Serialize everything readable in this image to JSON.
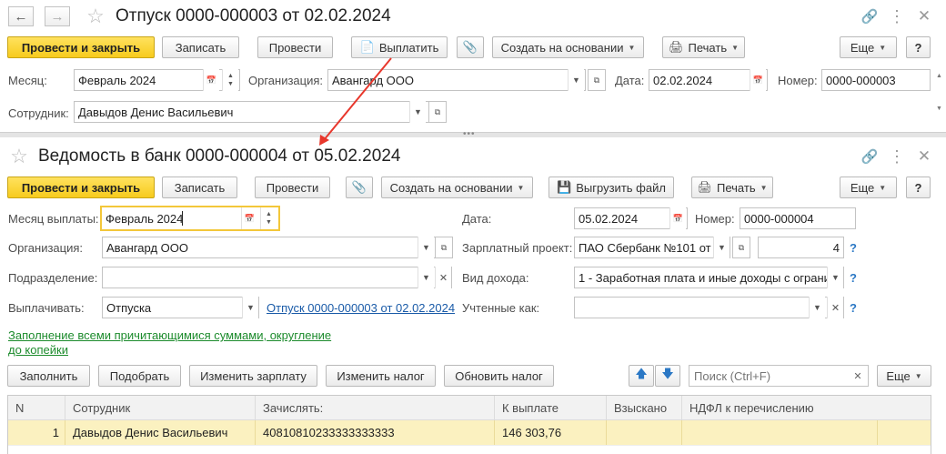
{
  "doc1": {
    "title": "Отпуск 0000-000003 от 02.02.2024",
    "toolbar": {
      "post_close": "Провести и закрыть",
      "save": "Записать",
      "post": "Провести",
      "pay": "Выплатить",
      "create_based": "Создать на основании",
      "print": "Печать",
      "more": "Еще",
      "help": "?"
    },
    "fields": {
      "month_label": "Месяц:",
      "month_value": "Февраль 2024",
      "org_label": "Организация:",
      "org_value": "Авангард ООО",
      "date_label": "Дата:",
      "date_value": "02.02.2024",
      "number_label": "Номер:",
      "number_value": "0000-000003",
      "employee_label": "Сотрудник:",
      "employee_value": "Давыдов Денис Васильевич"
    }
  },
  "doc2": {
    "title": "Ведомость в банк 0000-000004 от 05.02.2024",
    "toolbar": {
      "post_close": "Провести и закрыть",
      "save": "Записать",
      "post": "Провести",
      "create_based": "Создать на основании",
      "export": "Выгрузить файл",
      "print": "Печать",
      "more": "Еще",
      "help": "?"
    },
    "fields": {
      "pay_month_label": "Месяц выплаты:",
      "pay_month_value": "Февраль 2024",
      "date_label": "Дата:",
      "date_value": "05.02.2024",
      "number_label": "Номер:",
      "number_value": "0000-000004",
      "org_label": "Организация:",
      "org_value": "Авангард ООО",
      "salary_project_label": "Зарплатный проект:",
      "salary_project_value": "ПАО Сбербанк №101 от",
      "salary_project_num": "4",
      "division_label": "Подразделение:",
      "division_value": "",
      "income_type_label": "Вид дохода:",
      "income_type_value": "1 - Заработная плата и иные доходы с ограни",
      "pay_label": "Выплачивать:",
      "pay_value": "Отпуска",
      "pay_link": "Отпуск 0000-000003 от 02.02.2024",
      "accounted_label": "Учтенные как:",
      "accounted_value": ""
    },
    "fill_link": "Заполнение всеми причитающимися суммами, округление до копейки",
    "table_toolbar": {
      "fill": "Заполнить",
      "pick": "Подобрать",
      "change_salary": "Изменить зарплату",
      "change_tax": "Изменить налог",
      "update_tax": "Обновить налог",
      "search_placeholder": "Поиск (Ctrl+F)",
      "more": "Еще"
    },
    "table": {
      "columns": [
        "N",
        "Сотрудник",
        "Зачислять:",
        "К выплате",
        "Взыскано",
        "НДФЛ к перечислению"
      ],
      "rows": [
        {
          "n": "1",
          "employee": "Давыдов Денис Васильевич",
          "account": "40810810233333333333",
          "to_pay": "146 303,76",
          "withheld": "",
          "ndfl": ""
        }
      ]
    }
  },
  "colors": {
    "accent_yellow": "#f7cb1d",
    "selected_row": "#fbf1c0",
    "arrow": "#e8372c",
    "link_blue": "#1a5ba8",
    "link_green": "#1c8b2c"
  }
}
